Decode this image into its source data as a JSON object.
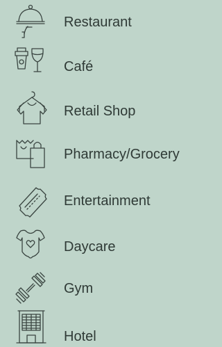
{
  "background": "#bfd5ca",
  "text_color": "#2f3a36",
  "items": [
    {
      "label": "Restaurant",
      "icon": "cloche-icon"
    },
    {
      "label": "Café",
      "icon": "coffee-cup-and-glass-icon"
    },
    {
      "label": "Retail Shop",
      "icon": "shirt-on-hanger-icon"
    },
    {
      "label": "Pharmacy/Grocery",
      "icon": "shopping-bags-icon"
    },
    {
      "label": "Entertainment",
      "icon": "ticket-icon"
    },
    {
      "label": "Daycare",
      "icon": "baby-onesie-icon"
    },
    {
      "label": "Gym",
      "icon": "dumbbell-icon"
    },
    {
      "label": "Hotel",
      "icon": "hotel-building-icon"
    }
  ]
}
